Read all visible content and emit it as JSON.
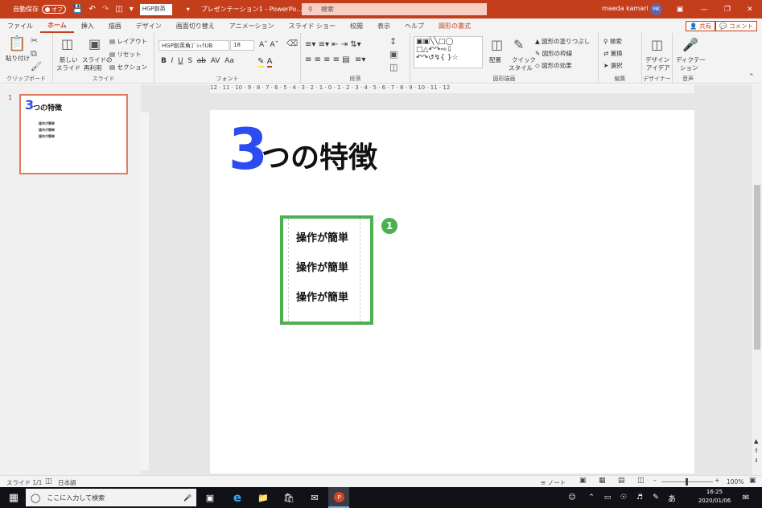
{
  "titlebar": {
    "autosave_label": "自動保存",
    "autosave_state": "オフ",
    "font_name": "HGP創英",
    "doc_title": "プレゼンテーション1 - PowerPo...",
    "search_placeholder": "検索",
    "user_name": "maeda kamari",
    "user_initials": "MK"
  },
  "tabs": [
    "ファイル",
    "ホーム",
    "挿入",
    "描画",
    "デザイン",
    "画面切り替え",
    "アニメーション",
    "スライド ショー",
    "校閲",
    "表示",
    "ヘルプ",
    "図形の書式"
  ],
  "share_label": "共有",
  "comment_label": "コメント",
  "ribbon": {
    "clipboard": {
      "paste": "貼り付け",
      "group": "クリップボード"
    },
    "slides": {
      "new_slide": "新しい",
      "new_slide2": "スライド",
      "reuse": "スライドの",
      "reuse2": "再利用",
      "layout": "レイアウト",
      "reset": "リセット",
      "section": "セクション",
      "group": "スライド"
    },
    "font": {
      "font_name": "HGP創英角ｺﾞｼｯｸUB",
      "font_size": "18",
      "group": "フォント"
    },
    "paragraph": {
      "group": "段落"
    },
    "drawing": {
      "arrange": "配置",
      "quick_style": "クイック",
      "quick_style2": "スタイル",
      "fill": "図形の塗りつぶし",
      "outline": "図形の枠線",
      "effects": "図形の効果",
      "group": "図形描画"
    },
    "editing": {
      "find": "検索",
      "replace": "置換",
      "select": "選択",
      "group": "編集"
    },
    "designer": {
      "ideas": "デザイン",
      "ideas2": "アイデア",
      "group": "デザイナー"
    },
    "voice": {
      "dictate": "ディクテー",
      "dictate2": "ション",
      "group": "音声"
    }
  },
  "ruler_h": "12 · 11 · 10 · 9 · 8 · 7 · 6 · 5 · 4 · 3 · 2 · 1 · 0 · 1 · 2 · 3 · 4 · 5 · 6 · 7 · 8 · 9 · 10 · 11 · 12",
  "thumbnail": {
    "number": "1",
    "title_big": "3",
    "title_rest": "つの特徴",
    "items": [
      "操作が簡単",
      "操作が簡単",
      "操作が簡単"
    ]
  },
  "slide": {
    "title_number": "3",
    "title_text": "つの特徴",
    "features": [
      "操作が簡単",
      "操作が簡単",
      "操作が簡単"
    ],
    "badge": "1",
    "accent_color": "#2b4cf2",
    "box_color": "#4caf50"
  },
  "statusbar": {
    "slide_info": "スライド 1/1",
    "language": "日本語",
    "notes": "ノート",
    "zoom": "100%"
  },
  "taskbar": {
    "search_placeholder": "ここに入力して検索",
    "ime": "あ",
    "time": "16:25",
    "date": "2020/01/06"
  }
}
